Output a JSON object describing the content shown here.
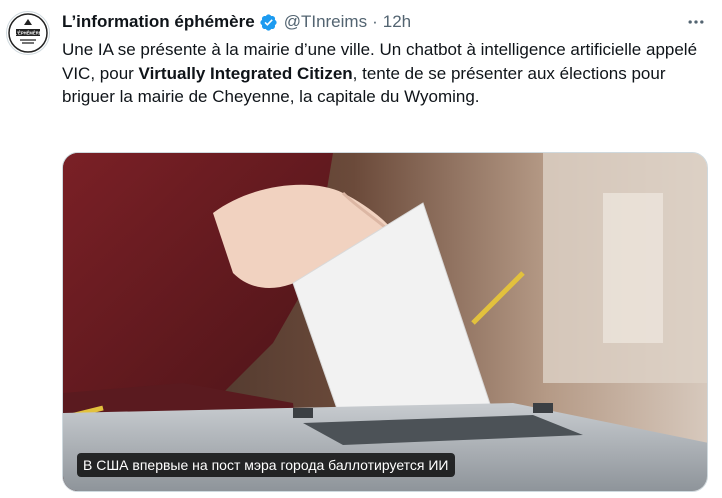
{
  "tweet": {
    "author_name": "L’information éphémère",
    "author_handle": "@TInreims",
    "separator": "·",
    "time": "12h",
    "avatar_text": "L'ÉPHÉMÈRE",
    "text_part1": "Une IA se présente à la mairie d’une ville. Un chatbot à intelligence artificielle appelé VIC, pour ",
    "text_bold": "Virtually Integrated Citizen",
    "text_part2": ", tente de se présenter aux élections pour briguer la mairie de Cheyenne, la capitale du Wyoming.",
    "media_caption": "В США впервые на пост мэра города баллотируется ИИ"
  },
  "icons": {
    "verified": "verified-badge-icon",
    "more": "more-options-icon"
  },
  "colors": {
    "verified_blue": "#1d9bf0",
    "text_primary": "#0f1419",
    "text_secondary": "#536471"
  }
}
